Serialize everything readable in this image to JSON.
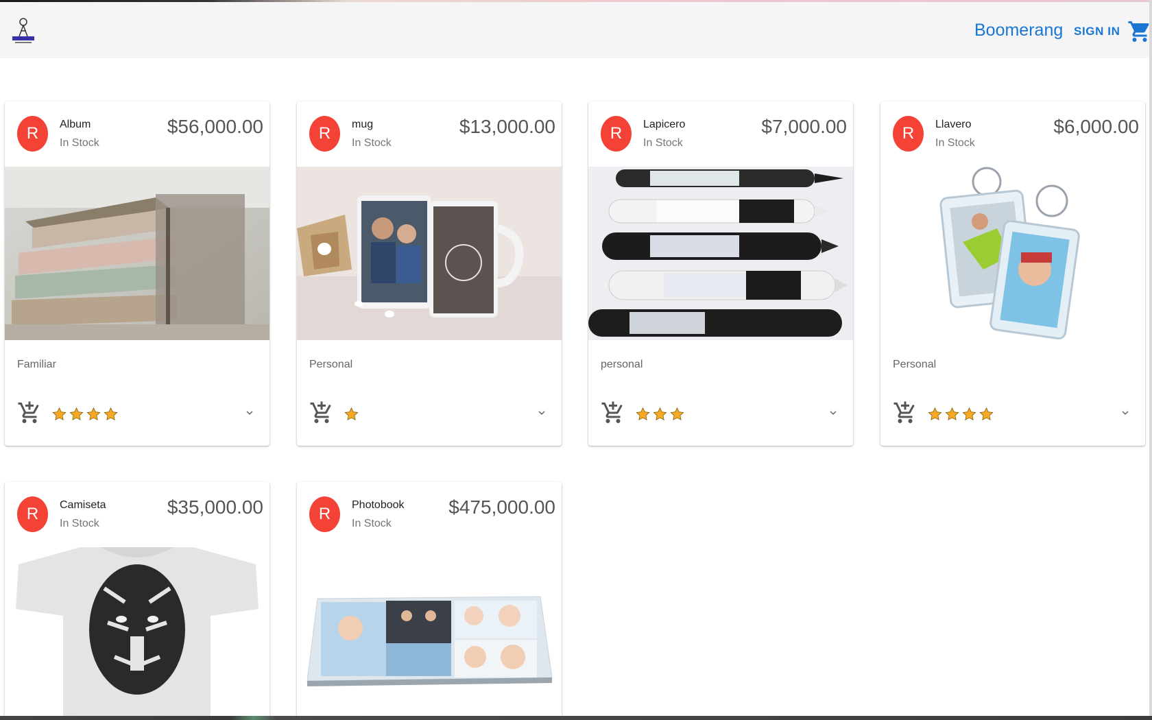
{
  "header": {
    "brand": "Boomerang",
    "sign_in": "SIGN IN",
    "logo_icon": "boomerang-logo",
    "cart_icon": "shopping-cart-icon",
    "accent_color": "#1976d2"
  },
  "products": [
    {
      "avatar": "R",
      "title": "Album",
      "stock": "In Stock",
      "price": "$56,000.00",
      "category": "Familiar",
      "rating": 4,
      "image": "stacked-photo-albums"
    },
    {
      "avatar": "R",
      "title": "mug",
      "stock": "In Stock",
      "price": "$13,000.00",
      "category": "Personal",
      "rating": 1,
      "image": "personalized-mugs"
    },
    {
      "avatar": "R",
      "title": "Lapicero",
      "stock": "In Stock",
      "price": "$7,000.00",
      "category": "personal",
      "rating": 3,
      "image": "branded-pens"
    },
    {
      "avatar": "R",
      "title": "Llavero",
      "stock": "In Stock",
      "price": "$6,000.00",
      "category": "Personal",
      "rating": 4,
      "image": "photo-keychains"
    },
    {
      "avatar": "R",
      "title": "Camiseta",
      "stock": "In Stock",
      "price": "$35,000.00",
      "image": "tiger-tshirt"
    },
    {
      "avatar": "R",
      "title": "Photobook",
      "stock": "In Stock",
      "price": "$475,000.00",
      "image": "baby-photobook"
    }
  ],
  "colors": {
    "avatar_bg": "#f44336",
    "star": "#f9a825",
    "appbar_bg": "#f5f5f5"
  }
}
